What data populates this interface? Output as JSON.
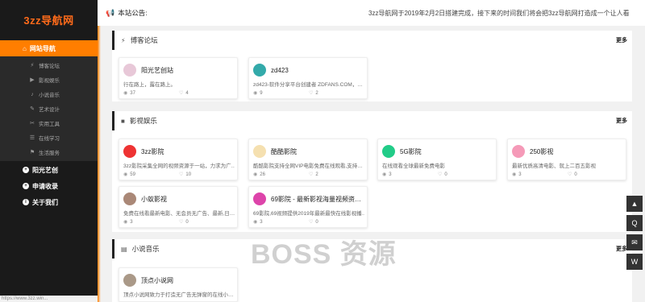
{
  "sidebar": {
    "logo": "3zz导航网",
    "main_label": "网站导航",
    "sub_items": [
      {
        "icon": "⚡",
        "label": "博客论坛"
      },
      {
        "icon": "▶",
        "label": "影视娱乐"
      },
      {
        "icon": "♪",
        "label": "小说音乐"
      },
      {
        "icon": "✎",
        "label": "艺术设计"
      },
      {
        "icon": "✂",
        "label": "实用工具"
      },
      {
        "icon": "☰",
        "label": "在线学习"
      },
      {
        "icon": "⚑",
        "label": "生活服务"
      }
    ],
    "items": [
      {
        "icon": "+",
        "label": "阳光艺创"
      },
      {
        "icon": "+",
        "label": "申请收录"
      },
      {
        "icon": "i",
        "label": "关于我们"
      }
    ],
    "footer": "https://www.3zz.win..."
  },
  "topbar": {
    "icon": "📢",
    "label": "本站公告:",
    "message": "3zz导航网于2019年2月2日搭建完成，接下来的时间我们将会把3zz导航网打造成一个让人看"
  },
  "sections": [
    {
      "icon": "⚡",
      "title": "博客论坛",
      "more": "更多"
    },
    {
      "icon": "■",
      "title": "影视娱乐",
      "more": "更多"
    },
    {
      "icon": "▤",
      "title": "小说音乐",
      "more": "更多"
    }
  ],
  "cards": {
    "blog": [
      {
        "name": "阳光艺创站",
        "desc": "行在路上，露在路上。",
        "views": "37",
        "likes": "4",
        "color": "#e8c8d8"
      },
      {
        "name": "zd423",
        "desc": "zd423-软件分享平台创建者 ZDFANS.COM，…",
        "views": "9",
        "likes": "2",
        "color": "#3aa"
      }
    ],
    "video": [
      {
        "name": "3zz影院",
        "desc": "3zz影院采集全网的视频资源于一站，力求为广…",
        "views": "59",
        "likes": "10",
        "color": "#e33"
      },
      {
        "name": "酷酷影院",
        "desc": "酷酷影院支持全网VIP电影免费在线观看,支持…",
        "views": "26",
        "likes": "2",
        "color": "#f5e0b0"
      },
      {
        "name": "5G影院",
        "desc": "在线观看全球最新免费电影",
        "views": "3",
        "likes": "0",
        "color": "#2c8"
      },
      {
        "name": "250影视",
        "desc": "最新优质高清电影、就上二百五影视",
        "views": "3",
        "likes": "0",
        "color": "#f59ab8"
      },
      {
        "name": "小蚁影视",
        "desc": "免费在线看最新电影、无会员无广告、最新,日…",
        "views": "3",
        "likes": "0",
        "color": "#a87"
      },
      {
        "name": "69影院 - 最新影视海量视频资…",
        "desc": "69影院,69视频提供2019年最新最快在线影视播…",
        "views": "3",
        "likes": "0",
        "color": "#d4a"
      }
    ],
    "novel": [
      {
        "name": "顶点小说网",
        "desc": "顶点小说网致力于打造无广告无弹窗的在线小…",
        "views": "",
        "likes": "",
        "color": "#a98"
      }
    ]
  },
  "watermark": "BOSS 资源",
  "float_buttons": [
    "▲",
    "Q",
    "✉",
    "W"
  ]
}
